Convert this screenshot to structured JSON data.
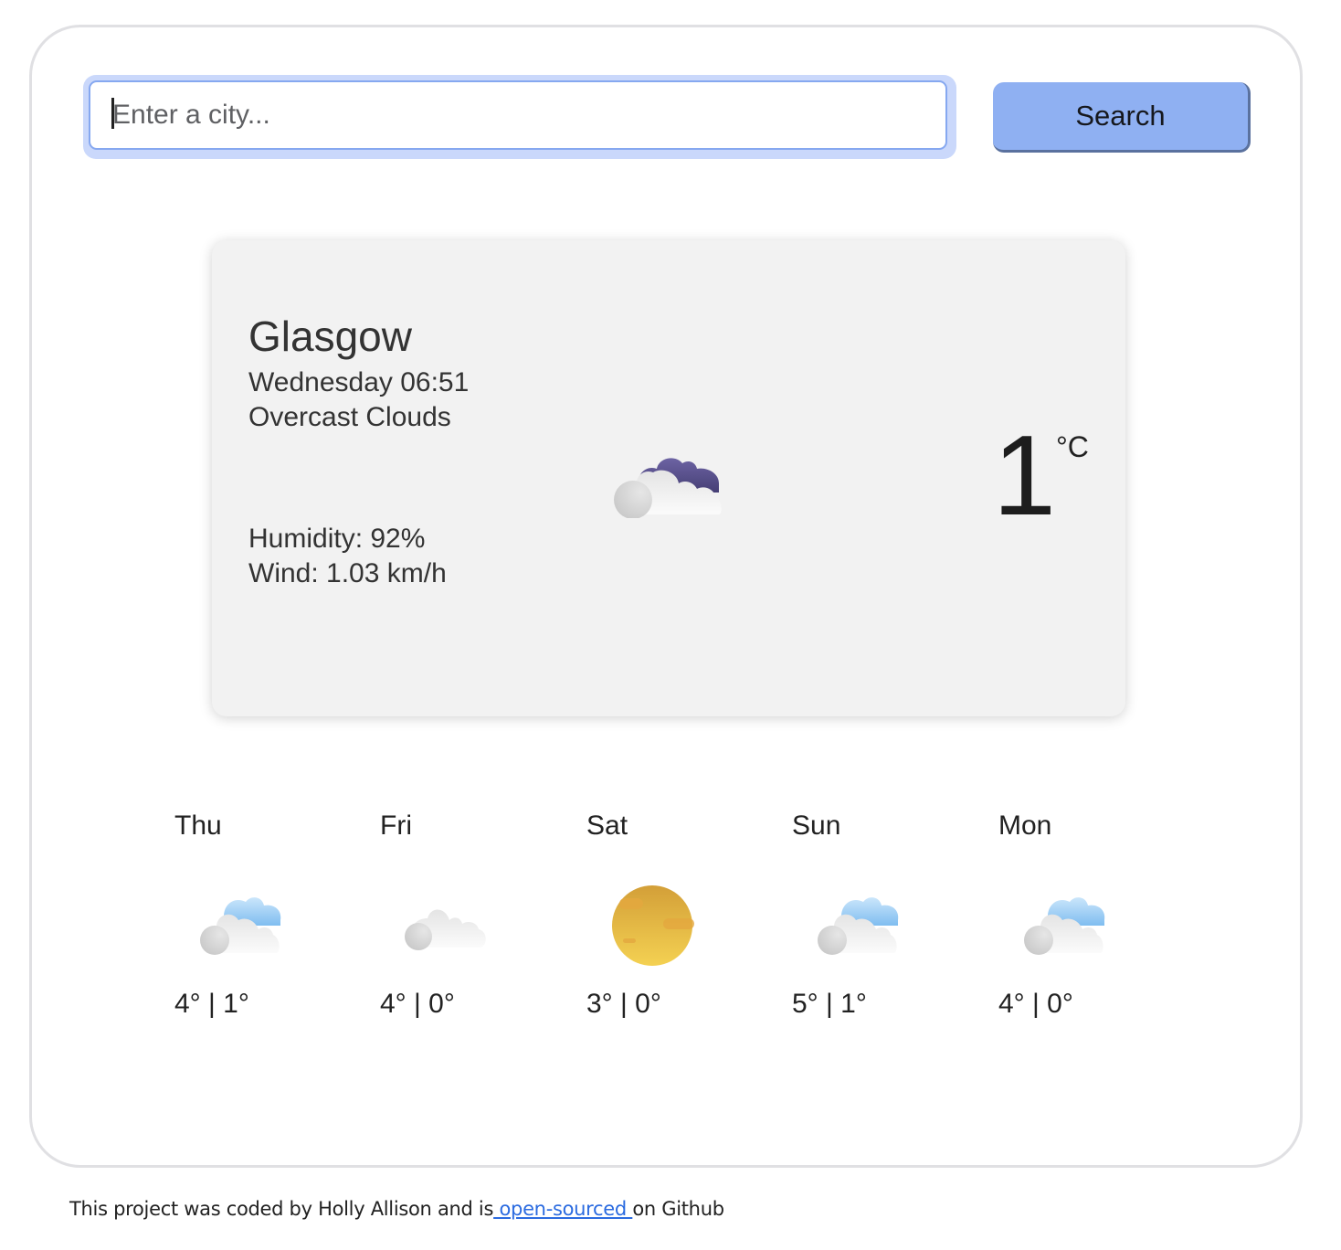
{
  "search": {
    "placeholder": "Enter a city...",
    "value": "",
    "button_label": "Search"
  },
  "current": {
    "city": "Glasgow",
    "datetime": "Wednesday 06:51",
    "description": "Overcast Clouds",
    "humidity": "Humidity: 92%",
    "wind": "Wind: 1.03 km/h",
    "temperature": "1",
    "unit": "°C",
    "icon": "overcast-clouds-icon"
  },
  "forecast": [
    {
      "day": "Thu",
      "temps": "4° | 1°",
      "icon": "partly-cloudy-icon"
    },
    {
      "day": "Fri",
      "temps": "4° | 0°",
      "icon": "cloud-icon"
    },
    {
      "day": "Sat",
      "temps": "3° | 0°",
      "icon": "sun-icon"
    },
    {
      "day": "Sun",
      "temps": "5° | 1°",
      "icon": "partly-cloudy-icon"
    },
    {
      "day": "Mon",
      "temps": "4° | 0°",
      "icon": "partly-cloudy-icon"
    }
  ],
  "footer": {
    "prefix": "This project was coded by Holly Allison and is",
    "link_text": " open-sourced ",
    "suffix": "on Github"
  },
  "colors": {
    "search_button_bg": "#8fb0f2",
    "input_focus_ring": "#cad8fb",
    "card_bg": "#f2f2f2",
    "link": "#2b6be0"
  }
}
